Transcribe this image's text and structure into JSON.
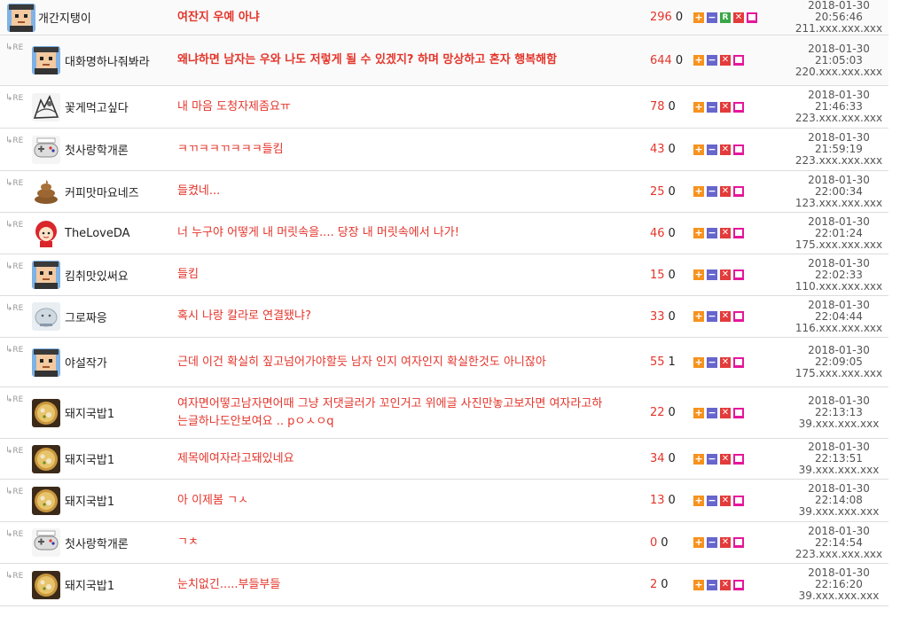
{
  "rows": [
    {
      "type": "root",
      "bold": true,
      "avatar": "face-avatar",
      "nick": "개간지탱이",
      "content": "여잔지 우예 아냐",
      "up": "296",
      "down": "0",
      "buttons": [
        "plus",
        "minus",
        "r",
        "x",
        "del"
      ],
      "date": "2018-01-30",
      "time": "20:56:46",
      "ip": "211.xxx.xxx.xxx"
    },
    {
      "type": "reply",
      "bold": true,
      "avatar": "face-avatar",
      "nick": "대화명하나줘봐라",
      "content": "왜냐하면 남자는 우와 나도 저렇게 될 수 있겠지? 하며 망상하고 혼자 행복해함",
      "up": "644",
      "down": "0",
      "buttons": [
        "plus",
        "minus",
        "x",
        "del"
      ],
      "date": "2018-01-30",
      "time": "21:05:03",
      "ip": "220.xxx.xxx.xxx"
    },
    {
      "type": "reply",
      "bold": false,
      "avatar": "sketch-avatar",
      "nick": "꽃게먹고싶다",
      "content": "내 마음 도청자제좀요ㅠ",
      "up": "78",
      "down": "0",
      "buttons": [
        "plus",
        "minus",
        "x",
        "del"
      ],
      "date": "2018-01-30",
      "time": "21:46:33",
      "ip": "223.xxx.xxx.xxx"
    },
    {
      "type": "reply",
      "bold": false,
      "avatar": "controller-avatar",
      "nick": "첫사랑학개론",
      "content": "ㅋㄲㅋㅋㄲㅋㅋㅋ들킴",
      "up": "43",
      "down": "0",
      "buttons": [
        "plus",
        "minus",
        "x",
        "del"
      ],
      "date": "2018-01-30",
      "time": "21:59:19",
      "ip": "223.xxx.xxx.xxx"
    },
    {
      "type": "reply",
      "bold": false,
      "avatar": "poop-avatar",
      "nick": "커피맛마요네즈",
      "content": "들켰네...",
      "up": "25",
      "down": "0",
      "buttons": [
        "plus",
        "minus",
        "x",
        "del"
      ],
      "date": "2018-01-30",
      "time": "22:00:34",
      "ip": "123.xxx.xxx.xxx"
    },
    {
      "type": "reply",
      "bold": false,
      "avatar": "redhair-avatar",
      "nick": "TheLoveDA",
      "content": "너 누구야 어떻게 내 머릿속을.... 당장 내 머릿속에서 나가!",
      "up": "46",
      "down": "0",
      "buttons": [
        "plus",
        "minus",
        "x",
        "del"
      ],
      "date": "2018-01-30",
      "time": "22:01:24",
      "ip": "175.xxx.xxx.xxx"
    },
    {
      "type": "reply",
      "bold": false,
      "avatar": "face-avatar",
      "nick": "킴취맛있써요",
      "content": "들킴",
      "up": "15",
      "down": "0",
      "buttons": [
        "plus",
        "minus",
        "x",
        "del"
      ],
      "date": "2018-01-30",
      "time": "22:02:33",
      "ip": "110.xxx.xxx.xxx"
    },
    {
      "type": "reply",
      "bold": false,
      "avatar": "blob-avatar",
      "nick": "그로짜응",
      "content": "혹시 나랑 칼라로 연결됐냐?",
      "up": "33",
      "down": "0",
      "buttons": [
        "plus",
        "minus",
        "x",
        "del"
      ],
      "date": "2018-01-30",
      "time": "22:04:44",
      "ip": "116.xxx.xxx.xxx"
    },
    {
      "type": "reply",
      "bold": false,
      "avatar": "face-avatar",
      "nick": "야설작가",
      "content": "근데 이건 확실히 짚고넘어가야할듯 남자 인지 여자인지 확실한것도 아니잖아",
      "up": "55",
      "down": "1",
      "buttons": [
        "plus",
        "minus",
        "x",
        "del"
      ],
      "date": "2018-01-30",
      "time": "22:09:05",
      "ip": "175.xxx.xxx.xxx"
    },
    {
      "type": "reply",
      "bold": false,
      "avatar": "soup-avatar",
      "nick": "돼지국밥1",
      "content": "여자면어떻고남자면어때 그냥 저댓글러가 꼬인거고 위에글 사진만놓고보자면 여자라고하는글하나도안보여요 .. pㅇㅅㅇq",
      "up": "22",
      "down": "0",
      "buttons": [
        "plus",
        "minus",
        "x",
        "del"
      ],
      "date": "2018-01-30",
      "time": "22:13:13",
      "ip": "39.xxx.xxx.xxx"
    },
    {
      "type": "reply",
      "bold": false,
      "avatar": "soup-avatar",
      "nick": "돼지국밥1",
      "content": "제목에여자라고돼있네요",
      "up": "34",
      "down": "0",
      "buttons": [
        "plus",
        "minus",
        "x",
        "del"
      ],
      "date": "2018-01-30",
      "time": "22:13:51",
      "ip": "39.xxx.xxx.xxx"
    },
    {
      "type": "reply",
      "bold": false,
      "avatar": "soup-avatar",
      "nick": "돼지국밥1",
      "content": "아 이제봄 ㄱㅅ",
      "up": "13",
      "down": "0",
      "buttons": [
        "plus",
        "minus",
        "x",
        "del"
      ],
      "date": "2018-01-30",
      "time": "22:14:08",
      "ip": "39.xxx.xxx.xxx"
    },
    {
      "type": "reply",
      "bold": false,
      "avatar": "controller-avatar",
      "nick": "첫사랑학개론",
      "content": "ㄱㅊ",
      "up": "0",
      "down": "0",
      "buttons": [
        "plus",
        "minus",
        "x",
        "del"
      ],
      "date": "2018-01-30",
      "time": "22:14:54",
      "ip": "223.xxx.xxx.xxx"
    },
    {
      "type": "reply",
      "bold": false,
      "avatar": "soup-avatar",
      "nick": "돼지국밥1",
      "content": "눈치없긴.....부들부들",
      "up": "2",
      "down": "0",
      "buttons": [
        "plus",
        "minus",
        "x",
        "del"
      ],
      "date": "2018-01-30",
      "time": "22:16:20",
      "ip": "39.xxx.xxx.xxx"
    }
  ],
  "reply_tag": "RE",
  "button_glyphs": {
    "plus": "+",
    "minus": "−",
    "r": "R",
    "x": "✕"
  }
}
